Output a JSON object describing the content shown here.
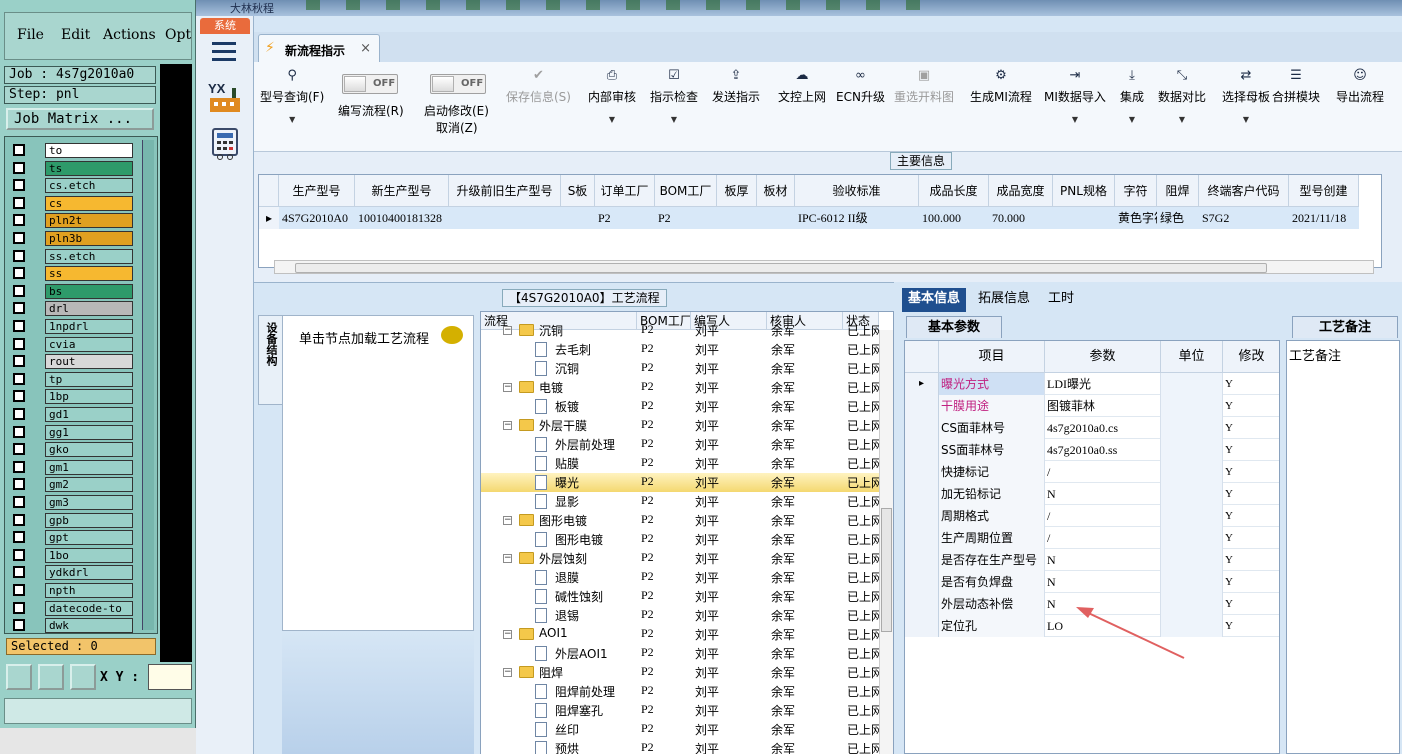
{
  "genesis": {
    "menu": [
      "File",
      "Edit",
      "Actions",
      "Opt"
    ],
    "job_label": "Job : 4s7g2010a0",
    "step_label": "Step: pnl",
    "matrix_button": "Job Matrix ...",
    "layers": [
      {
        "name": "to",
        "color": "#ffffff"
      },
      {
        "name": "ts",
        "color": "#2e9a6a"
      },
      {
        "name": "cs.etch",
        "color": "#9ad0c8"
      },
      {
        "name": "cs",
        "color": "#f6b830"
      },
      {
        "name": "pln2t",
        "color": "#e0a020"
      },
      {
        "name": "pln3b",
        "color": "#e0a020"
      },
      {
        "name": "ss.etch",
        "color": "#9ad0c8"
      },
      {
        "name": "ss",
        "color": "#f6b830"
      },
      {
        "name": "bs",
        "color": "#2e9a6a"
      },
      {
        "name": "drl",
        "color": "#b8b8b8"
      },
      {
        "name": "1npdrl",
        "color": "#9ad0c8"
      },
      {
        "name": "cvia",
        "color": "#9ad0c8"
      },
      {
        "name": "rout",
        "color": "#d8d8d8"
      },
      {
        "name": "tp",
        "color": "#9ad0c8"
      },
      {
        "name": "1bp",
        "color": "#9ad0c8"
      },
      {
        "name": "gd1",
        "color": "#9ad0c8"
      },
      {
        "name": "gg1",
        "color": "#9ad0c8"
      },
      {
        "name": "gko",
        "color": "#9ad0c8"
      },
      {
        "name": "gm1",
        "color": "#9ad0c8"
      },
      {
        "name": "gm2",
        "color": "#9ad0c8"
      },
      {
        "name": "gm3",
        "color": "#9ad0c8"
      },
      {
        "name": "gpb",
        "color": "#9ad0c8"
      },
      {
        "name": "gpt",
        "color": "#9ad0c8"
      },
      {
        "name": "1bo",
        "color": "#9ad0c8"
      },
      {
        "name": "ydkdrl",
        "color": "#9ad0c8"
      },
      {
        "name": "npth",
        "color": "#9ad0c8"
      },
      {
        "name": "datecode-to",
        "color": "#9ad0c8"
      },
      {
        "name": "dwk",
        "color": "#9ad0c8"
      }
    ],
    "selected": "Selected : 0",
    "xy_label": "X Y :"
  },
  "app": {
    "sys_tab": "系统",
    "yx_text": "YX",
    "title_fragment": "大林秋程",
    "tab_label": "新流程指示",
    "tab_close": "×"
  },
  "toolbar": {
    "buttons": [
      {
        "icon": "search-icon",
        "glyph": "⚲",
        "label": "型号查询(F)",
        "dropdown": true,
        "disabled": false
      },
      {
        "icon": "check-icon",
        "glyph": "✔",
        "label": "保存信息(S)",
        "dropdown": false,
        "disabled": true
      },
      {
        "icon": "print-icon",
        "glyph": "⎙",
        "label": "内部审核",
        "dropdown": true,
        "disabled": false
      },
      {
        "icon": "checkbox-icon",
        "glyph": "☑",
        "label": "指示检查",
        "dropdown": true,
        "disabled": false
      },
      {
        "icon": "upload-icon",
        "glyph": "⇪",
        "label": "发送指示",
        "dropdown": false,
        "disabled": false
      },
      {
        "icon": "cloud-upload-icon",
        "glyph": "☁",
        "label": "文控上网",
        "dropdown": false,
        "disabled": false
      },
      {
        "icon": "binoculars-icon",
        "glyph": "∞",
        "label": "ECN升级",
        "dropdown": false,
        "disabled": false
      },
      {
        "icon": "image-icon",
        "glyph": "▣",
        "label": "重选开料图",
        "dropdown": false,
        "disabled": true
      },
      {
        "icon": "gears-icon",
        "glyph": "⚙",
        "label": "生成MI流程",
        "dropdown": false,
        "disabled": false
      },
      {
        "icon": "import-icon",
        "glyph": "⇥",
        "label": "MI数据导入",
        "dropdown": true,
        "disabled": false
      },
      {
        "icon": "download-icon",
        "glyph": "⤓",
        "label": "集成",
        "dropdown": true,
        "disabled": false
      },
      {
        "icon": "compress-icon",
        "glyph": "⤡",
        "label": "数据对比",
        "dropdown": true,
        "disabled": false
      },
      {
        "icon": "shuffle-icon",
        "glyph": "⇄",
        "label": "选择母板",
        "dropdown": true,
        "disabled": false
      },
      {
        "icon": "list-icon",
        "glyph": "☰",
        "label": "合拼模块",
        "dropdown": false,
        "disabled": false
      },
      {
        "icon": "smile-icon",
        "glyph": "☺",
        "label": "导出流程",
        "dropdown": false,
        "disabled": false
      }
    ],
    "toggle1": {
      "state": "OFF",
      "label": "编写流程(R)"
    },
    "toggle2": {
      "state": "OFF",
      "label": "启动修改(E)",
      "label2": "取消(Z)"
    }
  },
  "main_info": {
    "title": "主要信息",
    "columns": [
      "生产型号",
      "新生产型号",
      "升级前旧生产型号",
      "S板",
      "订单工厂",
      "BOM工厂",
      "板厚",
      "板材",
      "验收标准",
      "成品长度",
      "成品宽度",
      "PNL规格",
      "字符",
      "阻焊",
      "终端客户代码",
      "型号创建"
    ],
    "row": [
      "4S7G2010A0",
      "10010400181328",
      "",
      "",
      "P2",
      "P2",
      "",
      "",
      "IPC-6012 II级",
      "100.000",
      "70.000",
      "",
      "黄色字符",
      "绿色",
      "S7G2",
      "2021/11/18"
    ]
  },
  "flow": {
    "title": "【4S7G2010A0】工艺流程",
    "vtab": "设备结构",
    "hint": "单击节点加载工艺流程",
    "columns": [
      "流程",
      "BOM工厂",
      "编写人",
      "核审人",
      "状态"
    ],
    "rows": [
      {
        "level": 0,
        "name": "沉铜",
        "bom": "P2",
        "writer": "刘平",
        "reviewer": "余军",
        "status": "已上网"
      },
      {
        "level": 1,
        "name": "去毛刺",
        "bom": "P2",
        "writer": "刘平",
        "reviewer": "余军",
        "status": "已上网"
      },
      {
        "level": 1,
        "name": "沉铜",
        "bom": "P2",
        "writer": "刘平",
        "reviewer": "余军",
        "status": "已上网"
      },
      {
        "level": 0,
        "name": "电镀",
        "bom": "P2",
        "writer": "刘平",
        "reviewer": "余军",
        "status": "已上网"
      },
      {
        "level": 1,
        "name": "板镀",
        "bom": "P2",
        "writer": "刘平",
        "reviewer": "余军",
        "status": "已上网"
      },
      {
        "level": 0,
        "name": "外层干膜",
        "bom": "P2",
        "writer": "刘平",
        "reviewer": "余军",
        "status": "已上网"
      },
      {
        "level": 1,
        "name": "外层前处理",
        "bom": "P2",
        "writer": "刘平",
        "reviewer": "余军",
        "status": "已上网"
      },
      {
        "level": 1,
        "name": "贴膜",
        "bom": "P2",
        "writer": "刘平",
        "reviewer": "余军",
        "status": "已上网"
      },
      {
        "level": 1,
        "name": "曝光",
        "bom": "P2",
        "writer": "刘平",
        "reviewer": "余军",
        "status": "已上网",
        "selected": true
      },
      {
        "level": 1,
        "name": "显影",
        "bom": "P2",
        "writer": "刘平",
        "reviewer": "余军",
        "status": "已上网"
      },
      {
        "level": 0,
        "name": "图形电镀",
        "bom": "P2",
        "writer": "刘平",
        "reviewer": "余军",
        "status": "已上网"
      },
      {
        "level": 1,
        "name": "图形电镀",
        "bom": "P2",
        "writer": "刘平",
        "reviewer": "余军",
        "status": "已上网"
      },
      {
        "level": 0,
        "name": "外层蚀刻",
        "bom": "P2",
        "writer": "刘平",
        "reviewer": "余军",
        "status": "已上网"
      },
      {
        "level": 1,
        "name": "退膜",
        "bom": "P2",
        "writer": "刘平",
        "reviewer": "余军",
        "status": "已上网"
      },
      {
        "level": 1,
        "name": "碱性蚀刻",
        "bom": "P2",
        "writer": "刘平",
        "reviewer": "余军",
        "status": "已上网"
      },
      {
        "level": 1,
        "name": "退锡",
        "bom": "P2",
        "writer": "刘平",
        "reviewer": "余军",
        "status": "已上网"
      },
      {
        "level": 0,
        "name": "AOI1",
        "bom": "P2",
        "writer": "刘平",
        "reviewer": "余军",
        "status": "已上网"
      },
      {
        "level": 1,
        "name": "外层AOI1",
        "bom": "P2",
        "writer": "刘平",
        "reviewer": "余军",
        "status": "已上网"
      },
      {
        "level": 0,
        "name": "阻焊",
        "bom": "P2",
        "writer": "刘平",
        "reviewer": "余军",
        "status": "已上网"
      },
      {
        "level": 1,
        "name": "阻焊前处理",
        "bom": "P2",
        "writer": "刘平",
        "reviewer": "余军",
        "status": "已上网"
      },
      {
        "level": 1,
        "name": "阻焊塞孔",
        "bom": "P2",
        "writer": "刘平",
        "reviewer": "余军",
        "status": "已上网"
      },
      {
        "level": 1,
        "name": "丝印",
        "bom": "P2",
        "writer": "刘平",
        "reviewer": "余军",
        "status": "已上网"
      },
      {
        "level": 1,
        "name": "预烘",
        "bom": "P2",
        "writer": "刘平",
        "reviewer": "余军",
        "status": "已上网"
      }
    ]
  },
  "right": {
    "tabs": [
      "基本信息",
      "拓展信息",
      "工时"
    ],
    "basic_label": "基本参数",
    "columns": [
      "项目",
      "参数",
      "单位",
      "修改"
    ],
    "params": [
      {
        "key": "曝光方式",
        "value": "LDI曝光",
        "unit": "",
        "mod": "Y",
        "key_color": "#c02080",
        "current": true
      },
      {
        "key": "干膜用途",
        "value": "图镀菲林",
        "unit": "",
        "mod": "Y",
        "key_color": "#c02080"
      },
      {
        "key": "CS面菲林号",
        "value": "4s7g2010a0.cs",
        "unit": "",
        "mod": "Y"
      },
      {
        "key": "SS面菲林号",
        "value": "4s7g2010a0.ss",
        "unit": "",
        "mod": "Y"
      },
      {
        "key": "快捷标记",
        "value": "/",
        "unit": "",
        "mod": "Y"
      },
      {
        "key": "加无铅标记",
        "value": "N",
        "unit": "",
        "mod": "Y"
      },
      {
        "key": "周期格式",
        "value": "/",
        "unit": "",
        "mod": "Y"
      },
      {
        "key": "生产周期位置",
        "value": "/",
        "unit": "",
        "mod": "Y"
      },
      {
        "key": "是否存在生产型号",
        "value": "N",
        "unit": "",
        "mod": "Y"
      },
      {
        "key": "是否有负焊盘",
        "value": "N",
        "unit": "",
        "mod": "Y"
      },
      {
        "key": "外层动态补偿",
        "value": "N",
        "unit": "",
        "mod": "Y"
      },
      {
        "key": "定位孔",
        "value": "LO",
        "unit": "",
        "mod": "Y"
      }
    ],
    "remark_label": "工艺备注",
    "remark_field": "工艺备注"
  },
  "colors": {
    "annotation_arrow": "#e06060",
    "selected_row": "#f4d870",
    "active_tab": "#1f4f8f"
  }
}
